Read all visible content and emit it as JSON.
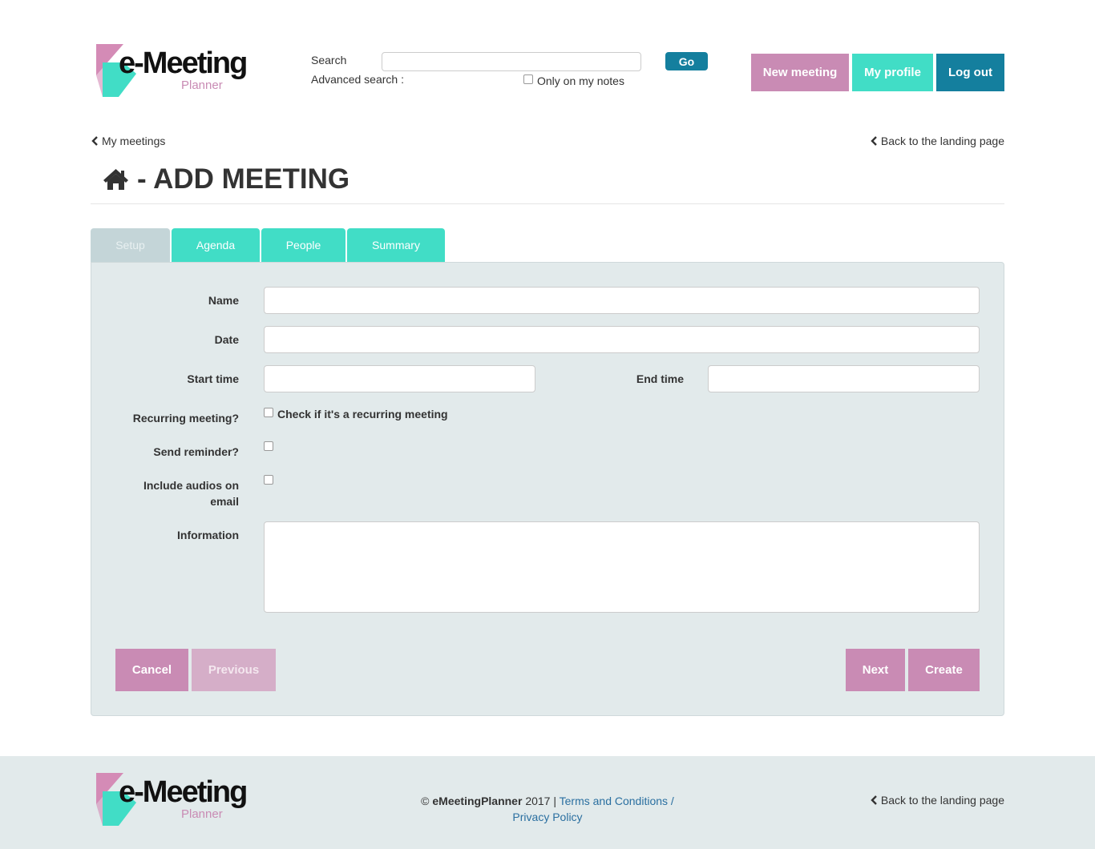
{
  "header": {
    "logo": {
      "word": "e-Meeting",
      "sub": "Planner"
    },
    "search_label": "Search",
    "search_value": "",
    "go_label": "Go",
    "advanced_search_label": "Advanced search :",
    "only_notes_label": "Only on my notes",
    "new_meeting_label": "New meeting",
    "my_profile_label": "My profile",
    "log_out_label": "Log out"
  },
  "nav": {
    "my_meetings": "My meetings",
    "back_landing": "Back to the landing page"
  },
  "page": {
    "title": "- ADD MEETING"
  },
  "tabs": [
    {
      "label": "Setup",
      "active": true
    },
    {
      "label": "Agenda"
    },
    {
      "label": "People"
    },
    {
      "label": "Summary"
    }
  ],
  "form": {
    "name_label": "Name",
    "name_value": "",
    "date_label": "Date",
    "date_value": "",
    "start_time_label": "Start time",
    "start_time_value": "",
    "end_time_label": "End time",
    "end_time_value": "",
    "recurring_label": "Recurring meeting?",
    "recurring_check_label": "Check if it's a recurring meeting",
    "reminder_label": "Send reminder?",
    "audios_label_1": "Include audios on",
    "audios_label_2": "email",
    "information_label": "Information",
    "information_value": ""
  },
  "actions": {
    "cancel": "Cancel",
    "previous": "Previous",
    "next": "Next",
    "create": "Create"
  },
  "footer": {
    "copyright_symbol": "©",
    "brand": "eMeetingPlanner",
    "year_sep": "2017 |",
    "terms": "Terms and Conditions /",
    "privacy": "Privacy Policy",
    "back_landing": "Back to the landing page"
  },
  "colors": {
    "pink": "#c98bb4",
    "teal": "#41ddc6",
    "dark_teal": "#147f9e",
    "panel_bg": "#e2eaeb"
  }
}
